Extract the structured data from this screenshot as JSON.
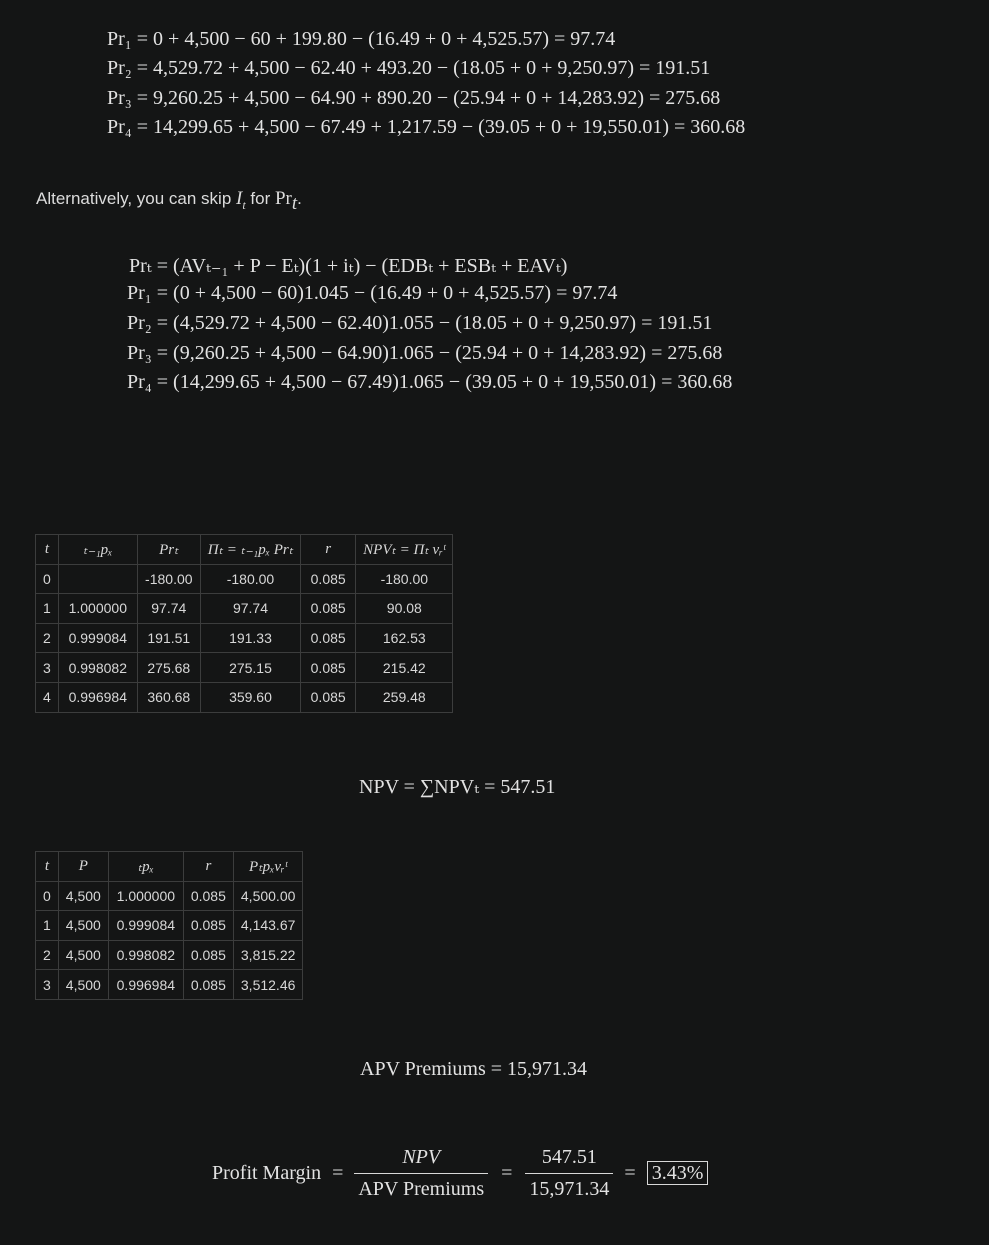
{
  "block1": {
    "lines": [
      "Pr₁ = 0 + 4,500 − 60 + 199.80 − (16.49 + 0 + 4,525.57) = 97.74",
      "Pr₂ = 4,529.72 + 4,500 − 62.40 + 493.20 − (18.05 + 0 + 9,250.97) = 191.51",
      "Pr₃ = 9,260.25 + 4,500 − 64.90 + 890.20 − (25.94 + 0 + 14,283.92) = 275.68",
      "Pr₄ = 14,299.65 + 4,500 − 67.49 + 1,217.59 − (39.05 + 0 + 19,550.01) = 360.68"
    ]
  },
  "prose": {
    "before": "Alternatively, you can skip ",
    "var_i": "I",
    "var_i_sub": "t",
    "middle": " for ",
    "var_pr": "Pr",
    "var_pr_sub": "t",
    "end": "."
  },
  "block2": {
    "lines": [
      "Prₜ = (AVₜ₋₁ + P − Eₜ)(1 + iₜ) − (EDBₜ + ESBₜ + EAVₜ)",
      "Pr₁ = (0 + 4,500 − 60)1.045 − (16.49 + 0 + 4,525.57) = 97.74",
      "Pr₂ = (4,529.72 + 4,500 − 62.40)1.055 − (18.05 + 0 + 9,250.97) = 191.51",
      "Pr₃ = (9,260.25 + 4,500 − 64.90)1.065 − (25.94 + 0 + 14,283.92) = 275.68",
      "Pr₄ = (14,299.65 + 4,500 − 67.49)1.065 − (39.05 + 0 + 19,550.01) = 360.68"
    ]
  },
  "table1": {
    "headers": [
      "t",
      "ₜ₋₁pₓ",
      "Prₜ",
      "Πₜ = ₜ₋₁pₓ Prₜ",
      "r",
      "NPVₜ = Πₜ vᵣᵗ"
    ],
    "rows": [
      [
        "0",
        "",
        "-180.00",
        "-180.00",
        "0.085",
        "-180.00"
      ],
      [
        "1",
        "1.000000",
        "97.74",
        "97.74",
        "0.085",
        "90.08"
      ],
      [
        "2",
        "0.999084",
        "191.51",
        "191.33",
        "0.085",
        "162.53"
      ],
      [
        "3",
        "0.998082",
        "275.68",
        "275.15",
        "0.085",
        "215.42"
      ],
      [
        "4",
        "0.996984",
        "360.68",
        "359.60",
        "0.085",
        "259.48"
      ]
    ]
  },
  "npv_sum": {
    "text": "NPV = ∑NPVₜ = 547.51"
  },
  "table2": {
    "headers": [
      "t",
      "P",
      "ₜpₓ",
      "r",
      "Pₜpₓvᵣᵗ"
    ],
    "rows": [
      [
        "0",
        "4,500",
        "1.000000",
        "0.085",
        "4,500.00"
      ],
      [
        "1",
        "4,500",
        "0.999084",
        "0.085",
        "4,143.67"
      ],
      [
        "2",
        "4,500",
        "0.998082",
        "0.085",
        "3,815.22"
      ],
      [
        "3",
        "4,500",
        "0.996984",
        "0.085",
        "3,512.46"
      ]
    ]
  },
  "apv": {
    "text": "APV Premiums = 15,971.34"
  },
  "profit_margin": {
    "label": "Profit Margin",
    "eq": "=",
    "frac1_num": "NPV",
    "frac1_den": "APV Premiums",
    "frac2_num": "547.51",
    "frac2_den": "15,971.34",
    "result": "3.43%"
  }
}
